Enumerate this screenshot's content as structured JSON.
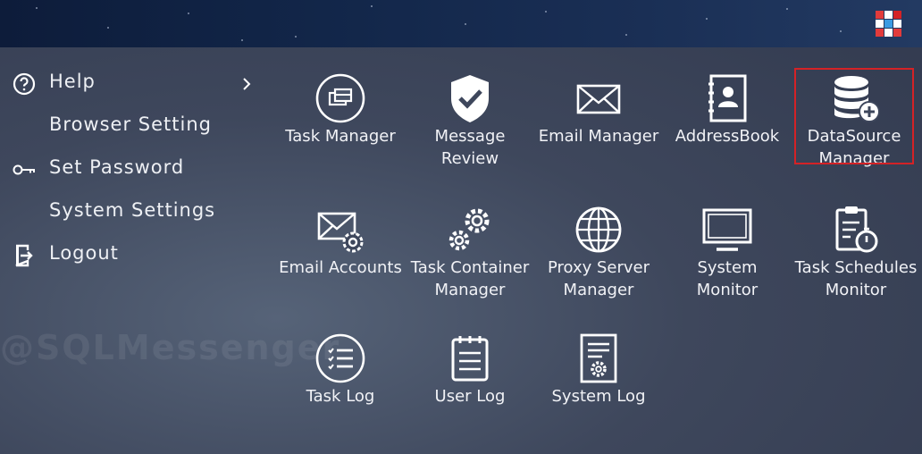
{
  "app": {
    "watermark": "@SQLMessenger"
  },
  "menu": {
    "items": [
      {
        "label": "Help",
        "icon": "help-circle-icon"
      },
      {
        "label": "Browser Setting"
      },
      {
        "label": "Set Password",
        "icon": "key-icon"
      },
      {
        "label": "System Settings"
      },
      {
        "label": "Logout",
        "icon": "logout-icon"
      }
    ]
  },
  "tiles": [
    {
      "label": "Task Manager",
      "icon": "task-manager-icon"
    },
    {
      "label": "Message\nReview",
      "icon": "shield-check-icon"
    },
    {
      "label": "Email Manager",
      "icon": "envelope-icon"
    },
    {
      "label": "AddressBook",
      "icon": "address-book-icon"
    },
    {
      "label": "DataSource\nManager",
      "icon": "database-add-icon",
      "highlighted": true
    },
    {
      "label": "Email Accounts",
      "icon": "email-settings-icon"
    },
    {
      "label": "Task Container\nManager",
      "icon": "gears-icon"
    },
    {
      "label": "Proxy Server\nManager",
      "icon": "globe-icon"
    },
    {
      "label": "System\nMonitor",
      "icon": "monitor-icon"
    },
    {
      "label": "Task Schedules\nMonitor",
      "icon": "clipboard-timer-icon"
    },
    {
      "label": "Task Log",
      "icon": "list-circle-icon"
    },
    {
      "label": "User Log",
      "icon": "notepad-icon"
    },
    {
      "label": "System Log",
      "icon": "document-gear-icon"
    }
  ],
  "colors": {
    "highlight_border": "#d42226",
    "topbar": "#122649"
  }
}
